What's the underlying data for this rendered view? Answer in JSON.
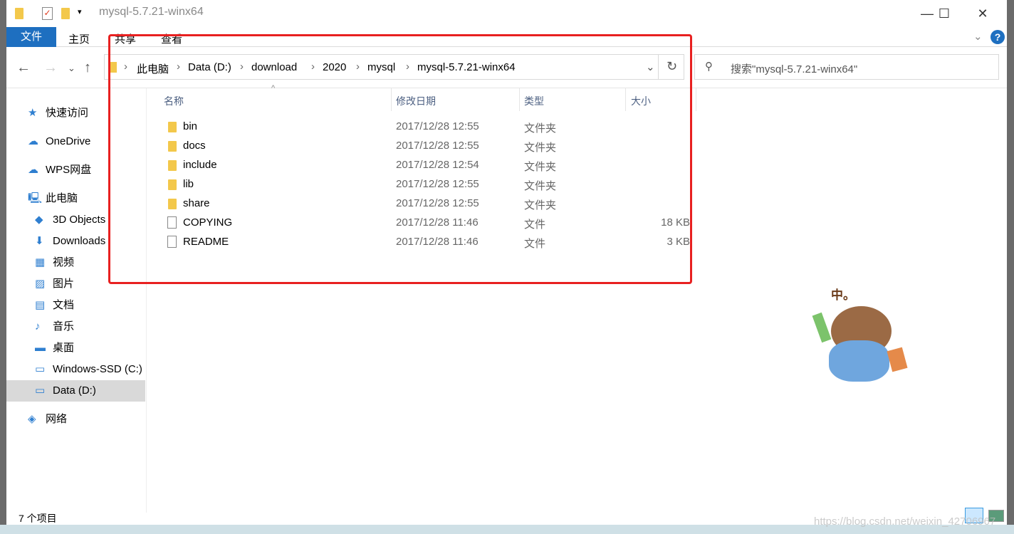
{
  "window": {
    "title": "mysql-5.7.21-winx64"
  },
  "ribbon": {
    "tabs": [
      "文件",
      "主页",
      "共享",
      "查看"
    ]
  },
  "address": {
    "crumbs": [
      "此电脑",
      "Data (D:)",
      "download",
      "2020",
      "mysql",
      "mysql-5.7.21-winx64"
    ]
  },
  "search": {
    "placeholder": "搜索\"mysql-5.7.21-winx64\""
  },
  "sidebar": {
    "items": [
      {
        "label": "快速访问",
        "icon": "star-icon"
      },
      {
        "label": "OneDrive",
        "icon": "cloud-icon"
      },
      {
        "label": "WPS网盘",
        "icon": "cloud-outline-icon"
      },
      {
        "label": "此电脑",
        "icon": "computer-icon"
      },
      {
        "label": "3D Objects",
        "icon": "cube-icon"
      },
      {
        "label": "Downloads",
        "icon": "download-icon"
      },
      {
        "label": "视频",
        "icon": "video-icon"
      },
      {
        "label": "图片",
        "icon": "picture-icon"
      },
      {
        "label": "文档",
        "icon": "document-icon"
      },
      {
        "label": "音乐",
        "icon": "music-icon"
      },
      {
        "label": "桌面",
        "icon": "desktop-icon"
      },
      {
        "label": "Windows-SSD (C:)",
        "icon": "drive-icon"
      },
      {
        "label": "Data (D:)",
        "icon": "drive-icon",
        "selected": true
      },
      {
        "label": "网络",
        "icon": "network-icon"
      }
    ]
  },
  "columns": [
    "名称",
    "修改日期",
    "类型",
    "大小"
  ],
  "files": [
    {
      "name": "bin",
      "date": "2017/12/28 12:55",
      "type": "文件夹",
      "size": "",
      "kind": "folder"
    },
    {
      "name": "docs",
      "date": "2017/12/28 12:55",
      "type": "文件夹",
      "size": "",
      "kind": "folder"
    },
    {
      "name": "include",
      "date": "2017/12/28 12:54",
      "type": "文件夹",
      "size": "",
      "kind": "folder"
    },
    {
      "name": "lib",
      "date": "2017/12/28 12:55",
      "type": "文件夹",
      "size": "",
      "kind": "folder"
    },
    {
      "name": "share",
      "date": "2017/12/28 12:55",
      "type": "文件夹",
      "size": "",
      "kind": "folder"
    },
    {
      "name": "COPYING",
      "date": "2017/12/28 11:46",
      "type": "文件",
      "size": "18 KB",
      "kind": "file"
    },
    {
      "name": "README",
      "date": "2017/12/28 11:46",
      "type": "文件",
      "size": "3 KB",
      "kind": "file"
    }
  ],
  "status": {
    "count": "7 个项目"
  },
  "sticker": {
    "text": "中。"
  },
  "watermark": "https://blog.csdn.net/weixin_42706967",
  "colors": {
    "accent": "#1e6fc0",
    "highlight": "#e82020"
  }
}
